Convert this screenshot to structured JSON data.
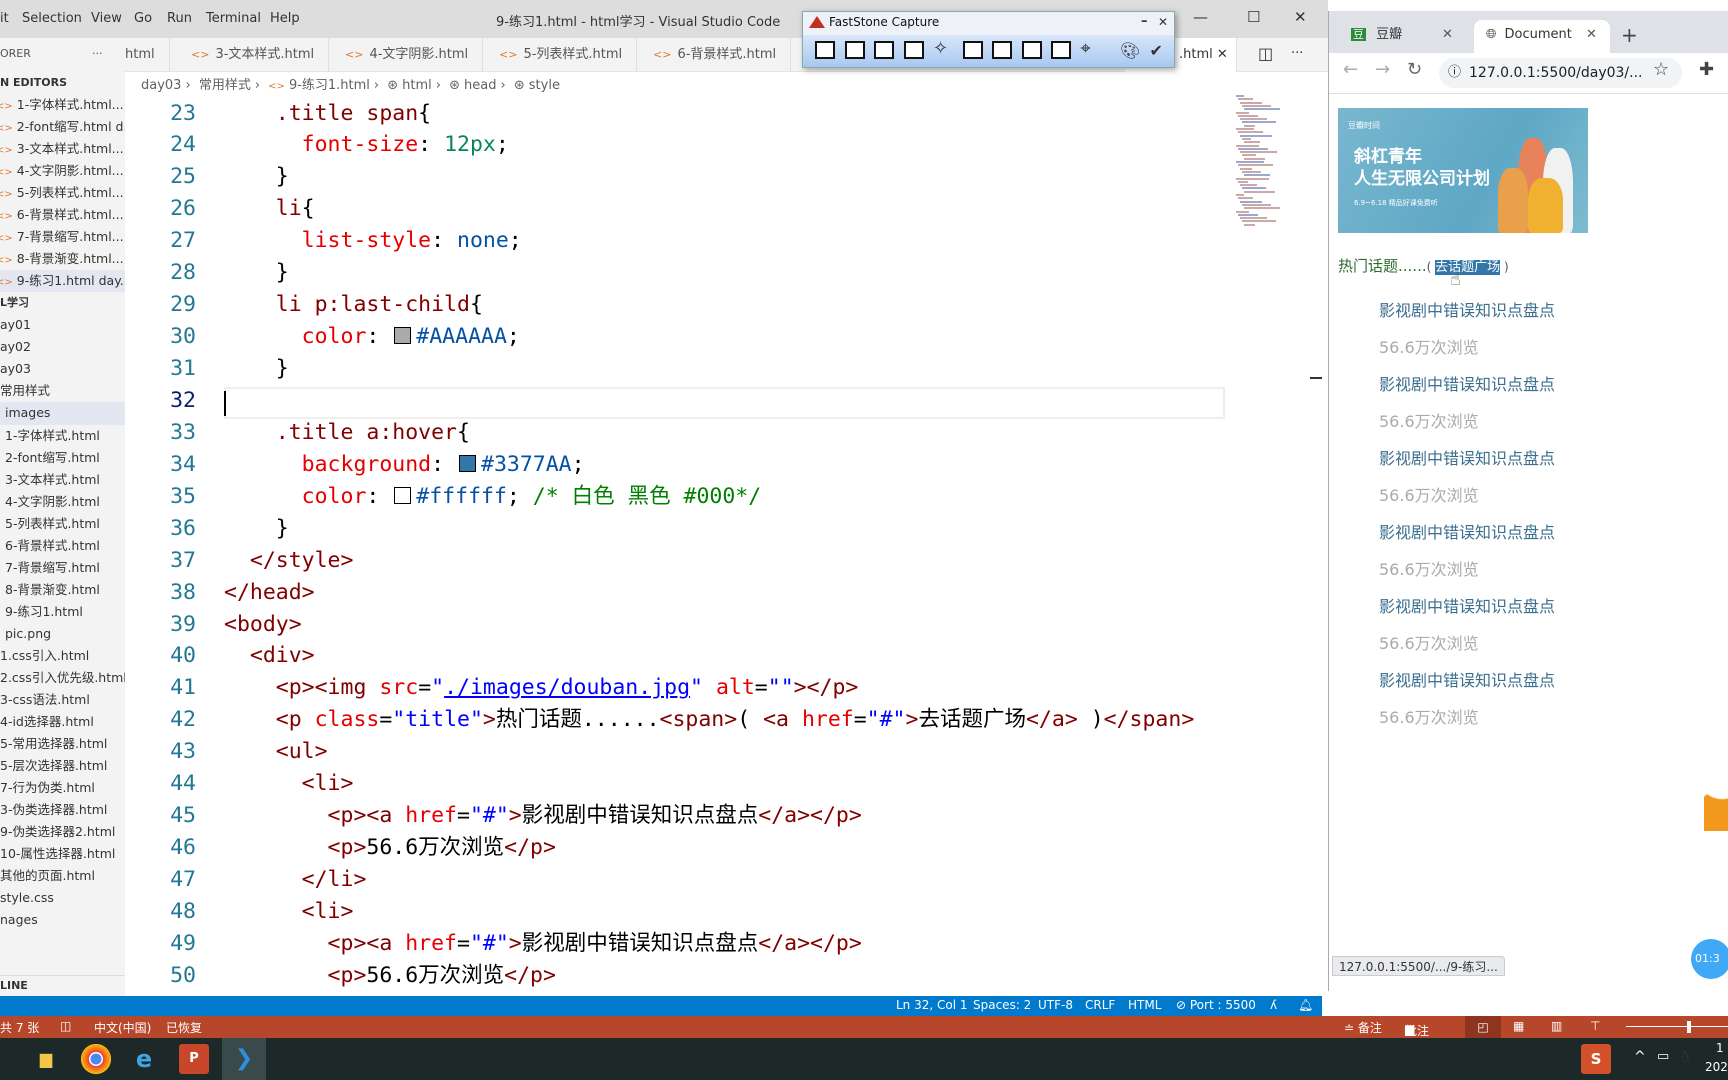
{
  "vscode": {
    "menu": [
      "it",
      "Selection",
      "View",
      "Go",
      "Run",
      "Terminal",
      "Help"
    ],
    "window_title": "9-练习1.html - html学习 - Visual Studio Code",
    "window_controls": {
      "minimize": "—",
      "maximize": "☐",
      "close": "✕"
    },
    "tabs": [
      {
        "label": "html",
        "icon": ""
      },
      {
        "label": "3-文本样式.html",
        "icon": "<>"
      },
      {
        "label": "4-文字阴影.html",
        "icon": "<>"
      },
      {
        "label": "5-列表样式.html",
        "icon": "<>"
      },
      {
        "label": "6-背景样式.html",
        "icon": "<>"
      },
      {
        "label": ".html",
        "icon": "",
        "active": true
      }
    ],
    "tab_close": "✕",
    "tab_actions": {
      "split": "◫",
      "more": "···"
    },
    "breadcrumb": [
      "day03",
      "常用样式",
      "9-练习1.html",
      "html",
      "head",
      "style"
    ],
    "breadcrumb_sep": "›",
    "sidebar": {
      "title": "ORER",
      "more": "···",
      "items": [
        {
          "label": "N EDITORS",
          "type": "header",
          "indent": 0
        },
        {
          "label": "1-字体样式.html...",
          "icon": true,
          "indent": 0
        },
        {
          "label": "2-font缩写.html  d...",
          "icon": true,
          "indent": 0
        },
        {
          "label": "3-文本样式.html...",
          "icon": true,
          "indent": 0
        },
        {
          "label": "4-文字阴影.html...",
          "icon": true,
          "indent": 0
        },
        {
          "label": "5-列表样式.html...",
          "icon": true,
          "indent": 0
        },
        {
          "label": "6-背景样式.html...",
          "icon": true,
          "indent": 0
        },
        {
          "label": "7-背景缩写.html...",
          "icon": true,
          "indent": 0
        },
        {
          "label": "8-背景渐变.html...",
          "icon": true,
          "indent": 0
        },
        {
          "label": "9-练习1.html  day...",
          "icon": true,
          "indent": 0,
          "selected": true
        },
        {
          "label": "L学习",
          "type": "header",
          "indent": 0
        },
        {
          "label": "ay01",
          "indent": 0
        },
        {
          "label": "ay02",
          "indent": 0
        },
        {
          "label": "ay03",
          "indent": 0
        },
        {
          "label": "常用样式",
          "indent": 0
        },
        {
          "label": "images",
          "indent": 1,
          "selected": true
        },
        {
          "label": "1-字体样式.html",
          "indent": 1
        },
        {
          "label": "2-font缩写.html",
          "indent": 1
        },
        {
          "label": "3-文本样式.html",
          "indent": 1
        },
        {
          "label": "4-文字阴影.html",
          "indent": 1
        },
        {
          "label": "5-列表样式.html",
          "indent": 1
        },
        {
          "label": "6-背景样式.html",
          "indent": 1
        },
        {
          "label": "7-背景缩写.html",
          "indent": 1
        },
        {
          "label": "8-背景渐变.html",
          "indent": 1
        },
        {
          "label": "9-练习1.html",
          "indent": 1
        },
        {
          "label": "pic.png",
          "indent": 1
        },
        {
          "label": "1.css引入.html",
          "indent": 0
        },
        {
          "label": "2.css引入优先级.html",
          "indent": 0
        },
        {
          "label": "3-css语法.html",
          "indent": 0
        },
        {
          "label": "4-id选择器.html",
          "indent": 0
        },
        {
          "label": "5-常用选择器.html",
          "indent": 0
        },
        {
          "label": "5-层次选择器.html",
          "indent": 0
        },
        {
          "label": "7-行为伪类.html",
          "indent": 0
        },
        {
          "label": "3-伪类选择器.html",
          "indent": 0
        },
        {
          "label": "9-伪类选择器2.html",
          "indent": 0
        },
        {
          "label": "10-属性选择器.html",
          "indent": 0
        },
        {
          "label": "其他的页面.html",
          "indent": 0
        },
        {
          "label": "style.css",
          "indent": 0
        },
        {
          "label": "nages",
          "indent": 0
        }
      ],
      "outline": "LINE"
    },
    "editor": {
      "current_line": 32,
      "lines": [
        {
          "n": 23,
          "t": [
            [
              "    ",
              "txt"
            ],
            [
              ".title span",
              "sel"
            ],
            [
              "{",
              "txt"
            ]
          ]
        },
        {
          "n": 24,
          "t": [
            [
              "      ",
              "txt"
            ],
            [
              "font-size",
              "prop"
            ],
            [
              ": ",
              "txt"
            ],
            [
              "12px",
              "num"
            ],
            [
              ";",
              "txt"
            ]
          ]
        },
        {
          "n": 25,
          "t": [
            [
              "    }",
              "txt"
            ]
          ]
        },
        {
          "n": 26,
          "t": [
            [
              "    ",
              "txt"
            ],
            [
              "li",
              "sel"
            ],
            [
              "{",
              "txt"
            ]
          ]
        },
        {
          "n": 27,
          "t": [
            [
              "      ",
              "txt"
            ],
            [
              "list-style",
              "prop"
            ],
            [
              ": ",
              "txt"
            ],
            [
              "none",
              "val"
            ],
            [
              ";",
              "txt"
            ]
          ]
        },
        {
          "n": 28,
          "t": [
            [
              "    }",
              "txt"
            ]
          ]
        },
        {
          "n": 29,
          "t": [
            [
              "    ",
              "txt"
            ],
            [
              "li p:last-child",
              "sel"
            ],
            [
              "{",
              "txt"
            ]
          ]
        },
        {
          "n": 30,
          "t": [
            [
              "      ",
              "txt"
            ],
            [
              "color",
              "prop"
            ],
            [
              ": ",
              "txt"
            ],
            [
              "",
              "swatch",
              "#AAAAAA"
            ],
            [
              "#AAAAAA",
              "val"
            ],
            [
              ";",
              "txt"
            ]
          ]
        },
        {
          "n": 31,
          "t": [
            [
              "    }",
              "txt"
            ]
          ]
        },
        {
          "n": 32,
          "t": []
        },
        {
          "n": 33,
          "t": [
            [
              "    ",
              "txt"
            ],
            [
              ".title a:hover",
              "sel"
            ],
            [
              "{",
              "txt"
            ]
          ]
        },
        {
          "n": 34,
          "t": [
            [
              "      ",
              "txt"
            ],
            [
              "background",
              "prop"
            ],
            [
              ": ",
              "txt"
            ],
            [
              "",
              "swatch",
              "#3377AA"
            ],
            [
              "#3377AA",
              "val"
            ],
            [
              ";",
              "txt"
            ]
          ]
        },
        {
          "n": 35,
          "t": [
            [
              "      ",
              "txt"
            ],
            [
              "color",
              "prop"
            ],
            [
              ": ",
              "txt"
            ],
            [
              "",
              "swatch",
              "#ffffff"
            ],
            [
              "#ffffff",
              "val"
            ],
            [
              "; ",
              "txt"
            ],
            [
              "/* 白色 黑色 #000*/",
              "com"
            ]
          ]
        },
        {
          "n": 36,
          "t": [
            [
              "    }",
              "txt"
            ]
          ]
        },
        {
          "n": 37,
          "t": [
            [
              "  </style>",
              "tag"
            ]
          ]
        },
        {
          "n": 38,
          "t": [
            [
              "</head>",
              "tag"
            ]
          ]
        },
        {
          "n": 39,
          "t": [
            [
              "<body>",
              "tag"
            ]
          ]
        },
        {
          "n": 40,
          "t": [
            [
              "  <div>",
              "tag"
            ]
          ]
        },
        {
          "n": 41,
          "t": [
            [
              "    <p><img ",
              "tag"
            ],
            [
              "src",
              "attr"
            ],
            [
              "=",
              "txt"
            ],
            [
              "\"",
              "str"
            ],
            [
              "./images/douban.jpg",
              "link"
            ],
            [
              "\"",
              "str"
            ],
            [
              " ",
              "txt"
            ],
            [
              "alt",
              "attr"
            ],
            [
              "=",
              "txt"
            ],
            [
              "\"\"",
              "str"
            ],
            [
              "></p>",
              "tag"
            ]
          ]
        },
        {
          "n": 42,
          "t": [
            [
              "    <p ",
              "tag"
            ],
            [
              "class",
              "attr"
            ],
            [
              "=",
              "txt"
            ],
            [
              "\"title\"",
              "str"
            ],
            [
              ">",
              "tag"
            ],
            [
              "热门话题......",
              "txt"
            ],
            [
              "<span>",
              "tag"
            ],
            [
              "( ",
              "txt"
            ],
            [
              "<a ",
              "tag"
            ],
            [
              "href",
              "attr"
            ],
            [
              "=",
              "txt"
            ],
            [
              "\"#\"",
              "str"
            ],
            [
              ">",
              "tag"
            ],
            [
              "去话题广场",
              "txt"
            ],
            [
              "</a>",
              "tag"
            ],
            [
              " )",
              "txt"
            ],
            [
              "</span>",
              "tag"
            ]
          ]
        },
        {
          "n": 43,
          "t": [
            [
              "    <ul>",
              "tag"
            ]
          ]
        },
        {
          "n": 44,
          "t": [
            [
              "      <li>",
              "tag"
            ]
          ]
        },
        {
          "n": 45,
          "t": [
            [
              "        <p><a ",
              "tag"
            ],
            [
              "href",
              "attr"
            ],
            [
              "=",
              "txt"
            ],
            [
              "\"#\"",
              "str"
            ],
            [
              ">",
              "tag"
            ],
            [
              "影视剧中错误知识点盘点",
              "txt"
            ],
            [
              "</a></p>",
              "tag"
            ]
          ]
        },
        {
          "n": 46,
          "t": [
            [
              "        <p>",
              "tag"
            ],
            [
              "56.6万次浏览",
              "txt"
            ],
            [
              "</p>",
              "tag"
            ]
          ]
        },
        {
          "n": 47,
          "t": [
            [
              "      </li>",
              "tag"
            ]
          ]
        },
        {
          "n": 48,
          "t": [
            [
              "      <li>",
              "tag"
            ]
          ]
        },
        {
          "n": 49,
          "t": [
            [
              "        <p><a ",
              "tag"
            ],
            [
              "href",
              "attr"
            ],
            [
              "=",
              "txt"
            ],
            [
              "\"#\"",
              "str"
            ],
            [
              ">",
              "tag"
            ],
            [
              "影视剧中错误知识点盘点",
              "txt"
            ],
            [
              "</a></p>",
              "tag"
            ]
          ]
        },
        {
          "n": 50,
          "t": [
            [
              "        <p>",
              "tag"
            ],
            [
              "56.6万次浏览",
              "txt"
            ],
            [
              "</p>",
              "tag"
            ]
          ]
        }
      ]
    },
    "statusbar": {
      "position": "Ln 32, Col 1",
      "spaces": "Spaces: 2",
      "encoding": "UTF-8",
      "eol": "CRLF",
      "language": "HTML",
      "port": "⊘ Port : 5500",
      "feedback_icon": "person-icon",
      "bell_icon": "bell-icon"
    },
    "accent": "#007acc"
  },
  "faststone": {
    "title": "FastStone Capture",
    "controls": {
      "minimize": "–",
      "close": "✕"
    },
    "tools": [
      "open",
      "capture-window",
      "capture-object",
      "capture-rectangle",
      "capture-freehand",
      "capture-fullscreen",
      "capture-scrolling",
      "capture-fixed",
      "screen-recorder",
      "crosshair",
      "editor",
      "settings"
    ]
  },
  "browser": {
    "tabs": [
      {
        "label": "豆瓣",
        "icon": "豆",
        "active": false
      },
      {
        "label": "Document",
        "icon": "globe",
        "active": true
      }
    ],
    "tab_close": "✕",
    "new_tab": "+",
    "url": "127.0.0.1:5500/day03/...",
    "page": {
      "banner": {
        "brand": "豆瓣时间",
        "line1": "斜杠青年",
        "line2": "人生无限公司计划",
        "line3": "6.9~6.18 精品好课免费听"
      },
      "hot_title": "热门话题......",
      "paren_open": "( ",
      "hot_link": "去话题广场",
      "paren_close": " )",
      "items": [
        {
          "title": "影视剧中错误知识点盘点",
          "views": "56.6万次浏览"
        },
        {
          "title": "影视剧中错误知识点盘点",
          "views": "56.6万次浏览"
        },
        {
          "title": "影视剧中错误知识点盘点",
          "views": "56.6万次浏览"
        },
        {
          "title": "影视剧中错误知识点盘点",
          "views": "56.6万次浏览"
        },
        {
          "title": "影视剧中错误知识点盘点",
          "views": "56.6万次浏览"
        },
        {
          "title": "影视剧中错误知识点盘点",
          "views": "56.6万次浏览"
        }
      ],
      "link_color": "#3377AA",
      "views_color": "#AAAAAA"
    },
    "status_url": "127.0.0.1:5500/.../9-练习...",
    "timer": "01:3"
  },
  "ppt_statusbar": {
    "slides": "共 7 张",
    "language": "中文(中国)",
    "state": "已恢复",
    "notes": "≐ 备注",
    "comments": "批注",
    "zoom_level": 0.6
  },
  "taskbar": {
    "apps": [
      "file-explorer",
      "chrome",
      "internet-explorer",
      "powerpoint",
      "vscode"
    ],
    "clock_top": "1",
    "clock_bottom": "202"
  }
}
